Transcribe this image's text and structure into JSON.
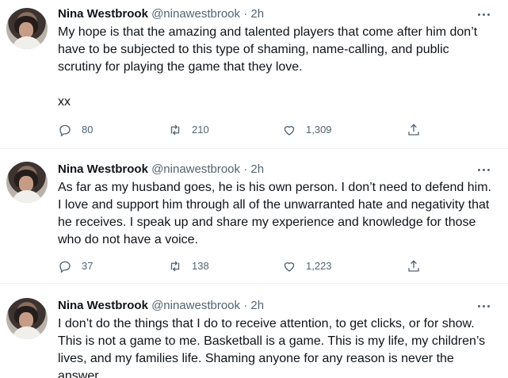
{
  "feed": {
    "tweets": [
      {
        "name": "Nina Westbrook",
        "handle": "@ninawestbrook",
        "separator": "·",
        "time": "2h",
        "text": "My hope is that the amazing and talented players that come after him don’t have to be subjected to this type of shaming, name-calling, and public scrutiny for playing the game that they love.\n\nxx",
        "replies": "80",
        "retweets": "210",
        "likes": "1,309"
      },
      {
        "name": "Nina Westbrook",
        "handle": "@ninawestbrook",
        "separator": "·",
        "time": "2h",
        "text": "As far as my husband goes, he is his own person. I don’t need to defend him. I love and support him through all of the unwarranted hate and negativity that he receives. I speak up and share my experience and knowledge for those who do not have a voice.",
        "replies": "37",
        "retweets": "138",
        "likes": "1,223"
      },
      {
        "name": "Nina Westbrook",
        "handle": "@ninawestbrook",
        "separator": "·",
        "time": "2h",
        "text": "I don’t do the things that I do to receive attention, to get clicks, or for show. This is not a game to me. Basketball is a game. This is my life, my children’s lives, and my families life. Shaming anyone for any reason is never the answer.",
        "replies": "",
        "retweets": "",
        "likes": ""
      }
    ]
  },
  "icons": {
    "reply": "reply-icon",
    "retweet": "retweet-icon",
    "like": "heart-icon",
    "share": "share-icon",
    "more": "more-dots-icon"
  },
  "colors": {
    "text": "#0f1419",
    "secondary": "#536471",
    "divider": "#eff3f4"
  }
}
